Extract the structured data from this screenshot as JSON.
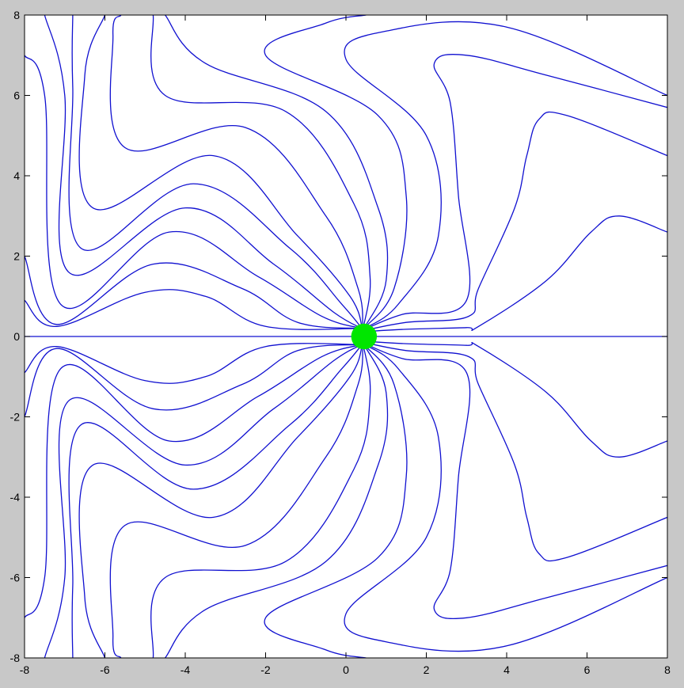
{
  "window": {
    "background_color": "#c8c8c8",
    "axes_background_color": "#ffffff"
  },
  "chart_data": {
    "type": "line",
    "description_kind": "contour field lines converging to a point",
    "xlim": [
      -8,
      8
    ],
    "ylim": [
      -8,
      8
    ],
    "xticks": [
      -8,
      -6,
      -4,
      -2,
      0,
      2,
      4,
      6,
      8
    ],
    "yticks": [
      -8,
      -6,
      -4,
      -2,
      0,
      2,
      4,
      6,
      8
    ],
    "x_tick_labels": [
      "-8",
      "-6",
      "-4",
      "-2",
      "0",
      "2",
      "4",
      "6",
      "8"
    ],
    "y_tick_labels": [
      "-8",
      "-6",
      "-4",
      "-2",
      "0",
      "2",
      "4",
      "6",
      "8"
    ],
    "grid": false,
    "line_color": "#1010d0",
    "marker": {
      "x": 0.45,
      "y": 0.0,
      "radius": 0.32,
      "color": "#00e600"
    },
    "symmetry": "mirror about y = 0",
    "series": [
      {
        "points": [
          [
            -8,
            0
          ],
          [
            8,
            0
          ]
        ]
      },
      {
        "points": [
          [
            0.45,
            0.12
          ],
          [
            1.5,
            0.18
          ],
          [
            3.0,
            0.22
          ],
          [
            3.3,
            0.25
          ],
          [
            5.0,
            1.4
          ],
          [
            6.1,
            2.6
          ],
          [
            6.8,
            3.0
          ],
          [
            8,
            2.6
          ]
        ]
      },
      {
        "points": [
          [
            0.45,
            0.15
          ],
          [
            1.5,
            0.35
          ],
          [
            3.05,
            0.5
          ],
          [
            3.3,
            1.2
          ],
          [
            4.2,
            3.2
          ],
          [
            4.5,
            4.5
          ],
          [
            4.8,
            5.4
          ],
          [
            5.5,
            5.5
          ],
          [
            8,
            4.5
          ]
        ]
      },
      {
        "points": [
          [
            0.45,
            0.17
          ],
          [
            1.4,
            0.55
          ],
          [
            3.0,
            0.9
          ],
          [
            2.8,
            3.5
          ],
          [
            2.6,
            5.8
          ],
          [
            2.2,
            6.8
          ],
          [
            3.0,
            7.0
          ],
          [
            5.0,
            6.5
          ],
          [
            8,
            5.7
          ]
        ]
      },
      {
        "points": [
          [
            0.45,
            0.19
          ],
          [
            1.3,
            0.8
          ],
          [
            2.3,
            2.5
          ],
          [
            2.0,
            5.0
          ],
          [
            0.0,
            6.9
          ],
          [
            1.0,
            7.6
          ],
          [
            4.0,
            7.7
          ],
          [
            8,
            6.0
          ]
        ]
      },
      {
        "points": [
          [
            0.45,
            0.2
          ],
          [
            1.2,
            1.2
          ],
          [
            1.5,
            3.5
          ],
          [
            0.8,
            5.5
          ],
          [
            -2.0,
            7.0
          ],
          [
            -0.5,
            7.8
          ],
          [
            0.5,
            8.0
          ]
        ]
      },
      {
        "points": [
          [
            0.45,
            0.2
          ],
          [
            1.0,
            1.4
          ],
          [
            0.8,
            3.2
          ],
          [
            -0.5,
            5.6
          ],
          [
            -3.5,
            6.8
          ],
          [
            -4.5,
            8.0
          ]
        ]
      },
      {
        "points": [
          [
            0.43,
            0.2
          ],
          [
            0.6,
            1.5
          ],
          [
            0.2,
            3.3
          ],
          [
            -1.5,
            5.6
          ],
          [
            -4.5,
            6.0
          ],
          [
            -4.8,
            8.0
          ]
        ]
      },
      {
        "points": [
          [
            0.42,
            0.2
          ],
          [
            0.3,
            1.2
          ],
          [
            -0.5,
            3.0
          ],
          [
            -2.5,
            5.2
          ],
          [
            -5.5,
            4.7
          ],
          [
            -5.8,
            7.5
          ],
          [
            -5.6,
            8.0
          ]
        ]
      },
      {
        "points": [
          [
            0.41,
            0.2
          ],
          [
            0.1,
            1.0
          ],
          [
            -1.2,
            2.5
          ],
          [
            -3.3,
            4.5
          ],
          [
            -6.3,
            3.2
          ],
          [
            -6.5,
            6.5
          ],
          [
            -6.0,
            8.0
          ]
        ]
      },
      {
        "points": [
          [
            0.4,
            0.2
          ],
          [
            -0.1,
            0.8
          ],
          [
            -1.4,
            2.2
          ],
          [
            -3.8,
            3.8
          ],
          [
            -6.6,
            2.2
          ],
          [
            -6.8,
            6.2
          ],
          [
            -6.8,
            8.0
          ]
        ]
      },
      {
        "points": [
          [
            0.4,
            0.2
          ],
          [
            -0.3,
            0.6
          ],
          [
            -1.8,
            1.8
          ],
          [
            -4.0,
            3.2
          ],
          [
            -6.9,
            1.6
          ],
          [
            -7.0,
            6.0
          ],
          [
            -7.5,
            8.0
          ]
        ]
      },
      {
        "points": [
          [
            0.4,
            0.2
          ],
          [
            -0.6,
            0.5
          ],
          [
            -2.2,
            1.5
          ],
          [
            -4.4,
            2.6
          ],
          [
            -7.1,
            0.8
          ],
          [
            -7.5,
            6.0
          ],
          [
            -8,
            7.0
          ]
        ]
      },
      {
        "points": [
          [
            0.4,
            0.2
          ],
          [
            -1.2,
            0.35
          ],
          [
            -2.6,
            1.2
          ],
          [
            -4.8,
            1.8
          ],
          [
            -7.2,
            0.3
          ],
          [
            -8.0,
            2.0
          ]
        ]
      },
      {
        "points": [
          [
            0.4,
            0.2
          ],
          [
            -2.0,
            0.25
          ],
          [
            -3.5,
            1.0
          ],
          [
            -5.0,
            1.1
          ],
          [
            -7.2,
            0.25
          ],
          [
            -8.0,
            0.9
          ]
        ]
      }
    ]
  }
}
